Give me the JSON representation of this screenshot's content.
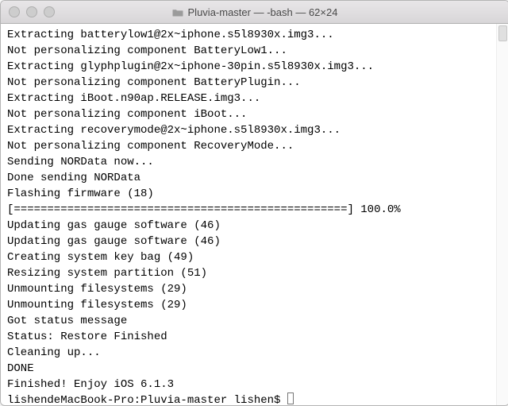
{
  "window": {
    "title": "Pluvia-master — -bash — 62×24"
  },
  "terminal": {
    "lines": [
      "Extracting batterylow1@2x~iphone.s5l8930x.img3...",
      "Not personalizing component BatteryLow1...",
      "Extracting glyphplugin@2x~iphone-30pin.s5l8930x.img3...",
      "Not personalizing component BatteryPlugin...",
      "Extracting iBoot.n90ap.RELEASE.img3...",
      "Not personalizing component iBoot...",
      "Extracting recoverymode@2x~iphone.s5l8930x.img3...",
      "Not personalizing component RecoveryMode...",
      "Sending NORData now...",
      "Done sending NORData",
      "Flashing firmware (18)",
      "[==================================================] 100.0%",
      "Updating gas gauge software (46)",
      "Updating gas gauge software (46)",
      "Creating system key bag (49)",
      "Resizing system partition (51)",
      "Unmounting filesystems (29)",
      "Unmounting filesystems (29)",
      "Got status message",
      "Status: Restore Finished",
      "Cleaning up...",
      "DONE",
      "Finished! Enjoy iOS 6.1.3"
    ],
    "prompt": "lishendeMacBook-Pro:Pluvia-master lishen$ "
  }
}
